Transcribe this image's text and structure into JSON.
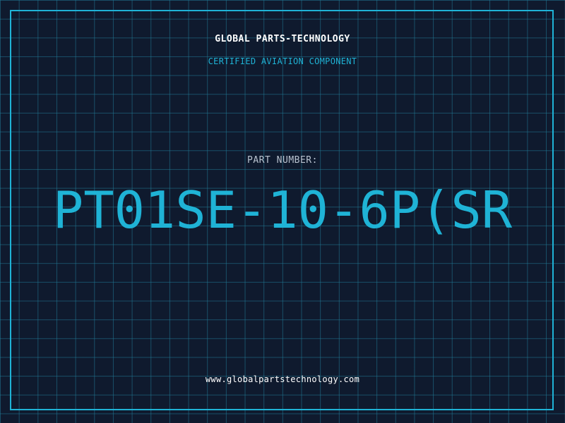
{
  "header": {
    "company_name": "GLOBAL PARTS-TECHNOLOGY",
    "tagline": "CERTIFIED AVIATION COMPONENT"
  },
  "part": {
    "label": "PART NUMBER:",
    "number": "PT01SE-10-6P(SR"
  },
  "footer": {
    "website": "www.globalpartstechnology.com"
  },
  "colors": {
    "background": "#0f1a2e",
    "grid": "#217a96",
    "accent": "#1fb3d6",
    "text": "#ffffff",
    "muted": "#b8c2cf"
  }
}
